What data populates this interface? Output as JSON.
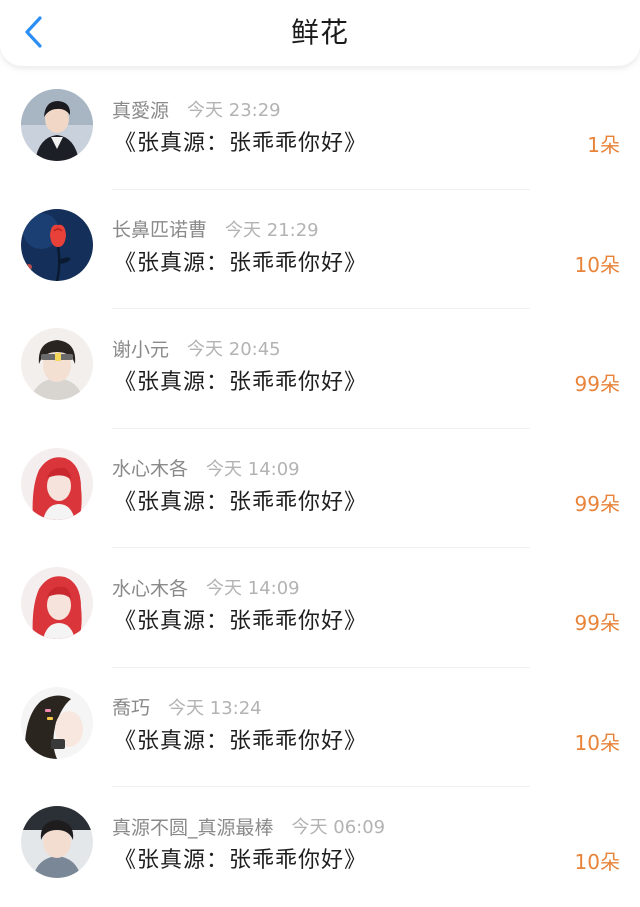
{
  "header": {
    "title": "鲜花",
    "back_icon": "chevron-left-icon",
    "accent_color": "#2b8ef5"
  },
  "count_color": "#e8833a",
  "items": [
    {
      "username": "真愛源",
      "time": "今天 23:29",
      "message": "《张真源：张乖乖你好》",
      "count": "1朵",
      "avatar": "young-man-in-jacket"
    },
    {
      "username": "长鼻匹诺曹",
      "time": "今天 21:29",
      "message": "《张真源：张乖乖你好》",
      "count": "10朵",
      "avatar": "red-rose-dark-blue"
    },
    {
      "username": "谢小元",
      "time": "今天 20:45",
      "message": "《张真源：张乖乖你好》",
      "count": "99朵",
      "avatar": "boy-with-headband"
    },
    {
      "username": "水心木各",
      "time": "今天 14:09",
      "message": "《张真源：张乖乖你好》",
      "count": "99朵",
      "avatar": "red-haired-girl"
    },
    {
      "username": "水心木各",
      "time": "今天 14:09",
      "message": "《张真源：张乖乖你好》",
      "count": "99朵",
      "avatar": "red-haired-girl"
    },
    {
      "username": "喬巧",
      "time": "今天 13:24",
      "message": "《张真源：张乖乖你好》",
      "count": "10朵",
      "avatar": "girl-with-hair-clips"
    },
    {
      "username": "真源不圆_真源最棒",
      "time": "今天 06:09",
      "message": "《张真源：张乖乖你好》",
      "count": "10朵",
      "avatar": "young-boy-portrait"
    }
  ]
}
